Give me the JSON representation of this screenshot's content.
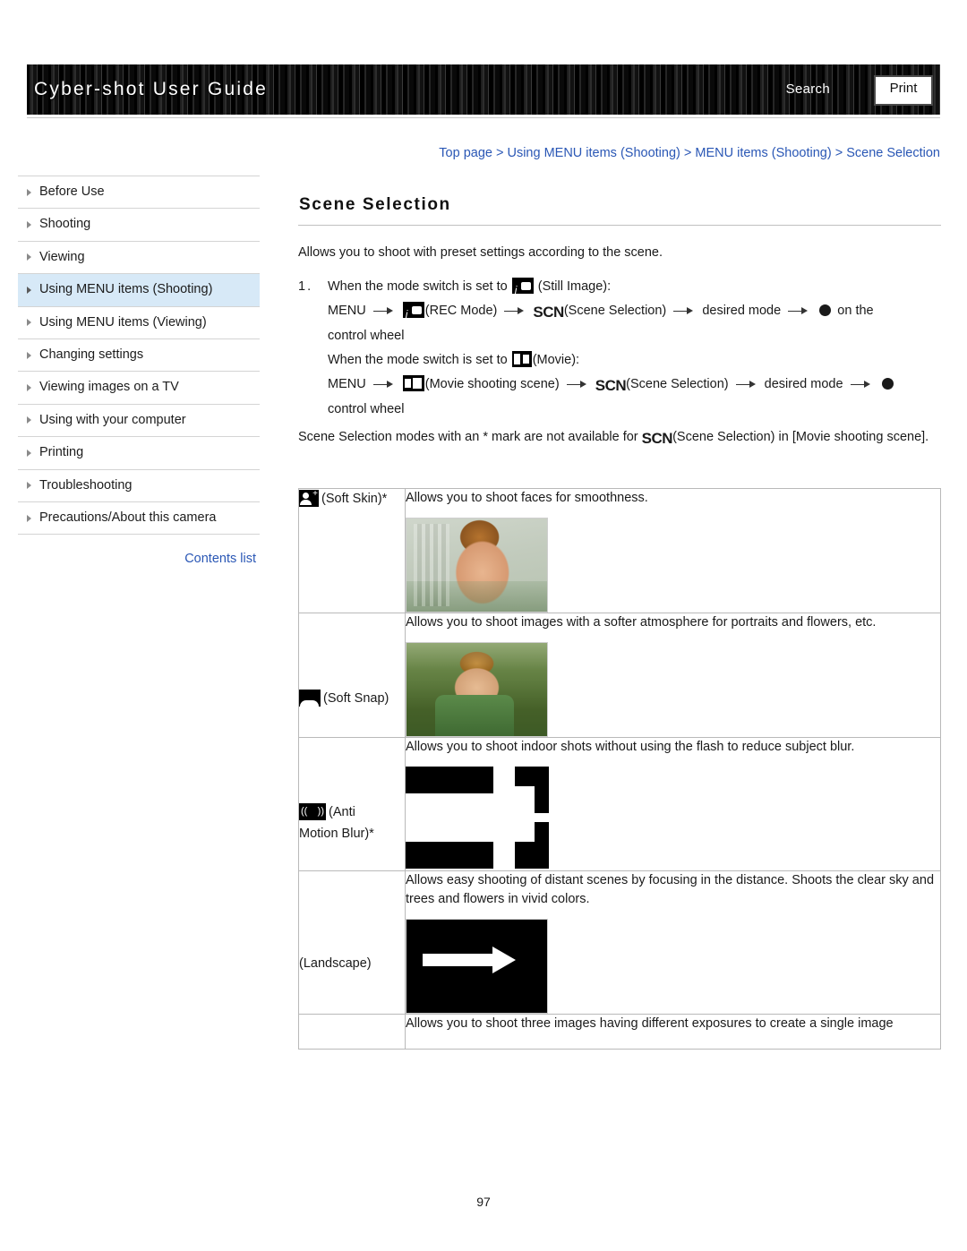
{
  "header": {
    "title": "Cyber-shot User Guide",
    "search_label": "Search",
    "print_label": "Print"
  },
  "breadcrumb": {
    "full": "Top page > Using MENU items (Shooting) > MENU items (Shooting) > Scene Selection",
    "items": [
      "Top page",
      "Using MENU items (Shooting)",
      "MENU items (Shooting)",
      "Scene Selection"
    ]
  },
  "sidebar": {
    "items": [
      {
        "label": "Before Use",
        "selected": false
      },
      {
        "label": "Shooting",
        "selected": false
      },
      {
        "label": "Viewing",
        "selected": false
      },
      {
        "label": "Using MENU items (Shooting)",
        "selected": true
      },
      {
        "label": "Using MENU items (Viewing)",
        "selected": false
      },
      {
        "label": "Changing settings",
        "selected": false
      },
      {
        "label": "Viewing images on a TV",
        "selected": false
      },
      {
        "label": "Using with your computer",
        "selected": false
      },
      {
        "label": "Printing",
        "selected": false
      },
      {
        "label": "Troubleshooting",
        "selected": false
      },
      {
        "label": "Precautions/About this camera",
        "selected": false
      }
    ],
    "contents_list_label": "Contents list"
  },
  "main": {
    "title": "Scene Selection",
    "intro": "Allows you to shoot with preset settings according to the scene.",
    "step1_number": "1.",
    "step1_lead": "When the mode switch is set to",
    "step1_still_label": "(Still Image):",
    "menu_label": "MENU",
    "rec_mode_label": "(REC Mode)",
    "scn_label": "SCN",
    "scene_selection_label": "(Scene Selection)",
    "desired_mode_label": "desired mode",
    "on_the_label": "on the",
    "control_wheel_label": "control wheel",
    "step1_movie_lead": "When the mode switch is set to",
    "movie_label": "(Movie):",
    "movie_shooting_scene_label": "(Movie shooting scene)",
    "note": "Scene Selection modes with an * mark are not available for",
    "note_tail": "(Scene Selection) in [Movie shooting scene]."
  },
  "table": {
    "rows": [
      {
        "mode_label": "(Soft Skin)*",
        "description": "Allows you to shoot faces for smoothness.",
        "has_image": true
      },
      {
        "mode_label": "(Soft Snap)",
        "description": "Allows you to shoot images with a softer atmosphere for portraits and flowers, etc.",
        "has_image": true
      },
      {
        "mode_label_line1": "(Anti",
        "mode_label_line2": "Motion Blur)*",
        "description": "Allows you to shoot indoor shots without using the flash to reduce subject blur.",
        "has_image": true
      },
      {
        "mode_label": "(Landscape)",
        "description": "Allows easy shooting of distant scenes by focusing in the distance. Shoots the clear sky and trees and flowers in vivid colors.",
        "has_image": true
      },
      {
        "mode_label": "",
        "description": "Allows you to shoot three images having different exposures to create a single image",
        "has_image": false
      }
    ]
  },
  "footer": {
    "page_number": "97"
  }
}
